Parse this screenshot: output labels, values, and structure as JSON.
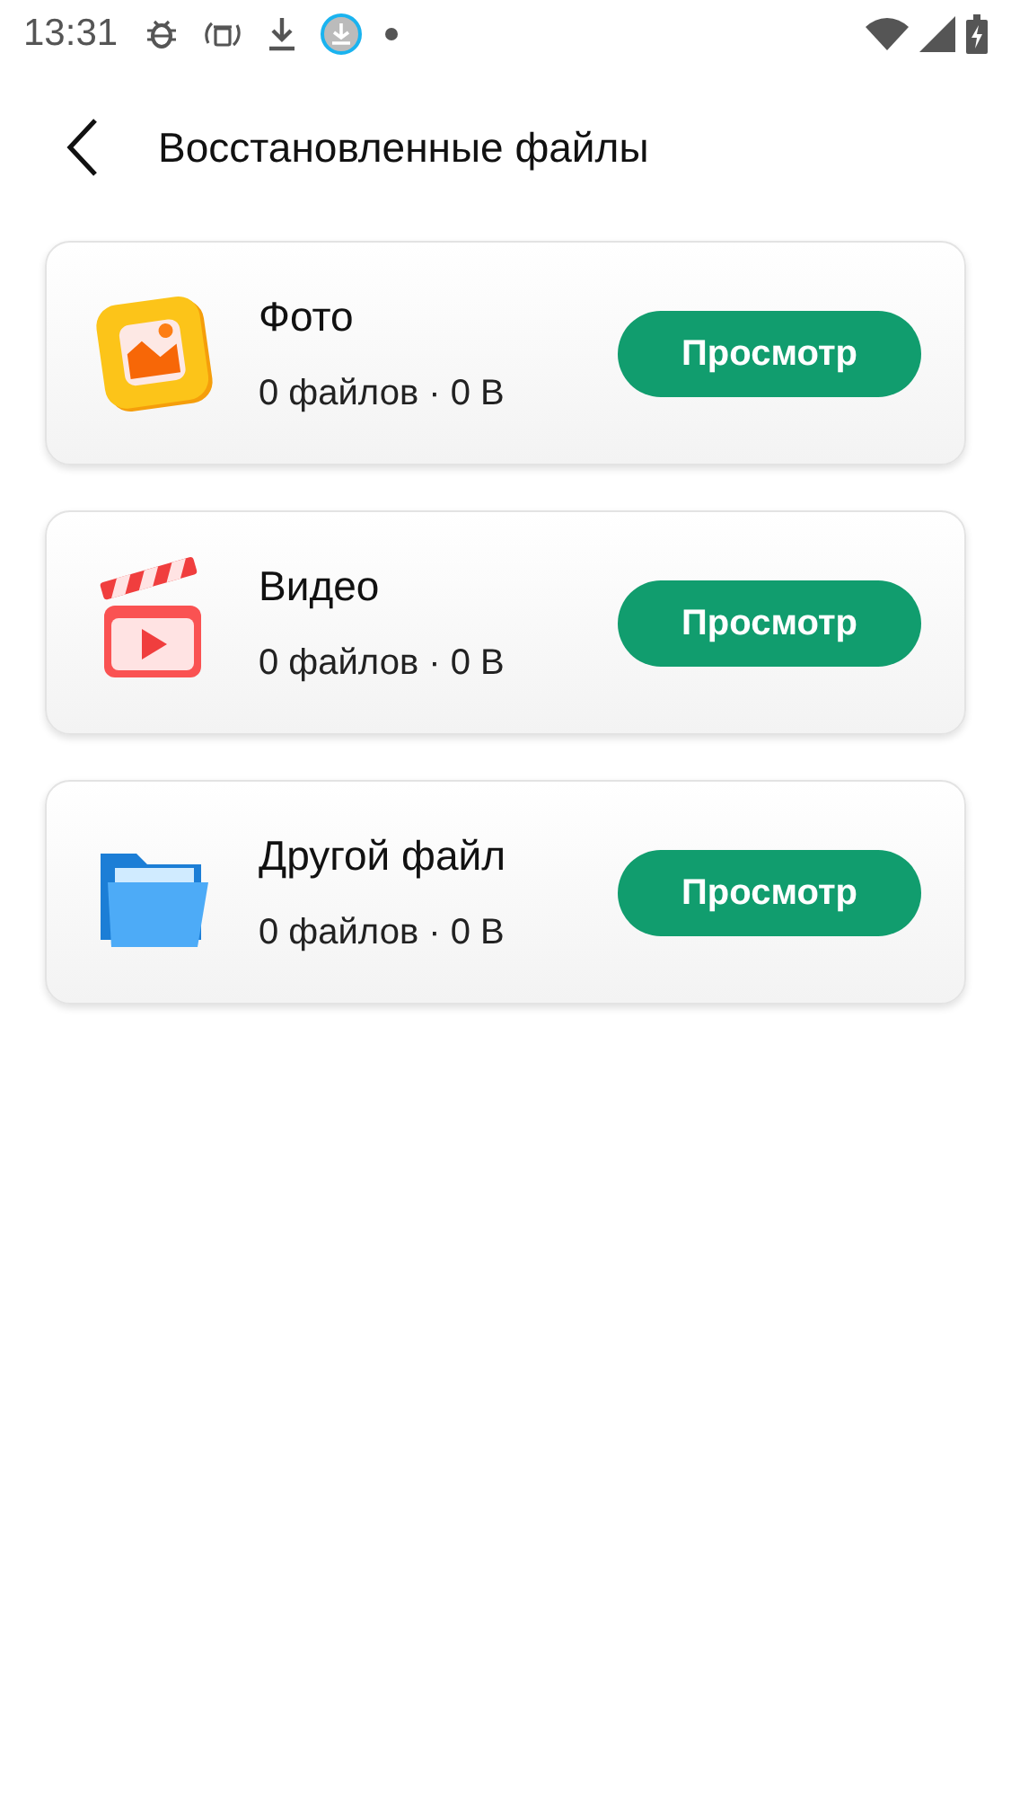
{
  "status_bar": {
    "time": "13:31"
  },
  "header": {
    "title": "Восстановленные файлы"
  },
  "categories": [
    {
      "kind": "photo",
      "title": "Фото",
      "details": "0 файлов · 0 B",
      "button": "Просмотр"
    },
    {
      "kind": "video",
      "title": "Видео",
      "details": "0 файлов · 0 B",
      "button": "Просмотр"
    },
    {
      "kind": "folder",
      "title": "Другой файл",
      "details": "0 файлов · 0 B",
      "button": "Просмотр"
    }
  ]
}
